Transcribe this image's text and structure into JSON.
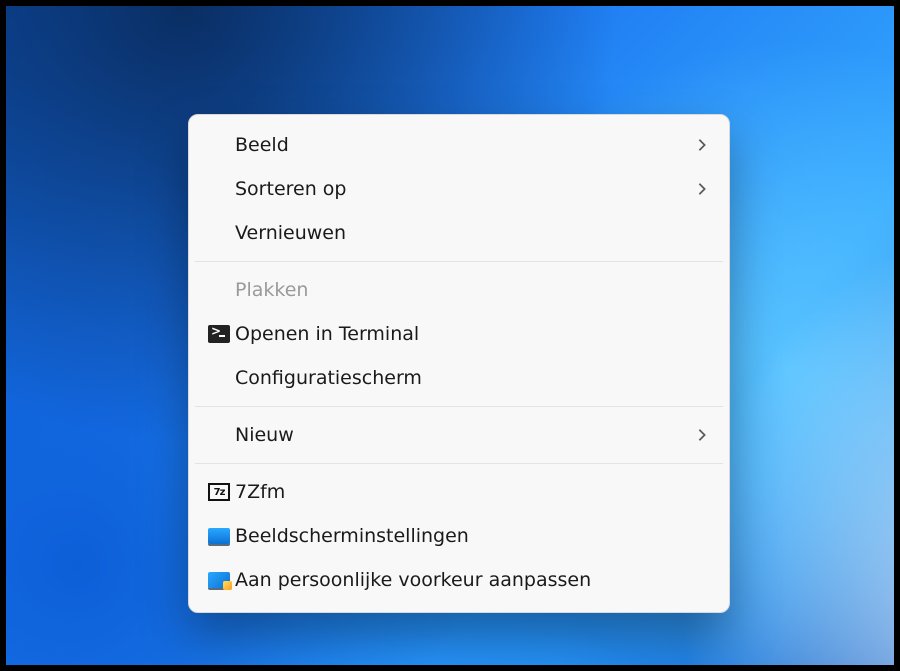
{
  "context_menu": {
    "groups": [
      [
        {
          "key": "view",
          "label": "Beeld",
          "submenu": true
        },
        {
          "key": "sortby",
          "label": "Sorteren op",
          "submenu": true
        },
        {
          "key": "refresh",
          "label": "Vernieuwen"
        }
      ],
      [
        {
          "key": "paste",
          "label": "Plakken",
          "disabled": true
        },
        {
          "key": "terminal",
          "label": "Openen in Terminal",
          "icon": "terminal-icon"
        },
        {
          "key": "controlpanel",
          "label": "Configuratiescherm"
        }
      ],
      [
        {
          "key": "new",
          "label": "Nieuw",
          "submenu": true
        }
      ],
      [
        {
          "key": "7zfm",
          "label": "7Zfm",
          "icon": "7z-icon"
        },
        {
          "key": "displaysettings",
          "label": "Beeldscherminstellingen",
          "icon": "display-icon"
        },
        {
          "key": "personalize",
          "label": "Aan persoonlijke voorkeur aanpassen",
          "icon": "personalize-icon"
        }
      ]
    ]
  }
}
